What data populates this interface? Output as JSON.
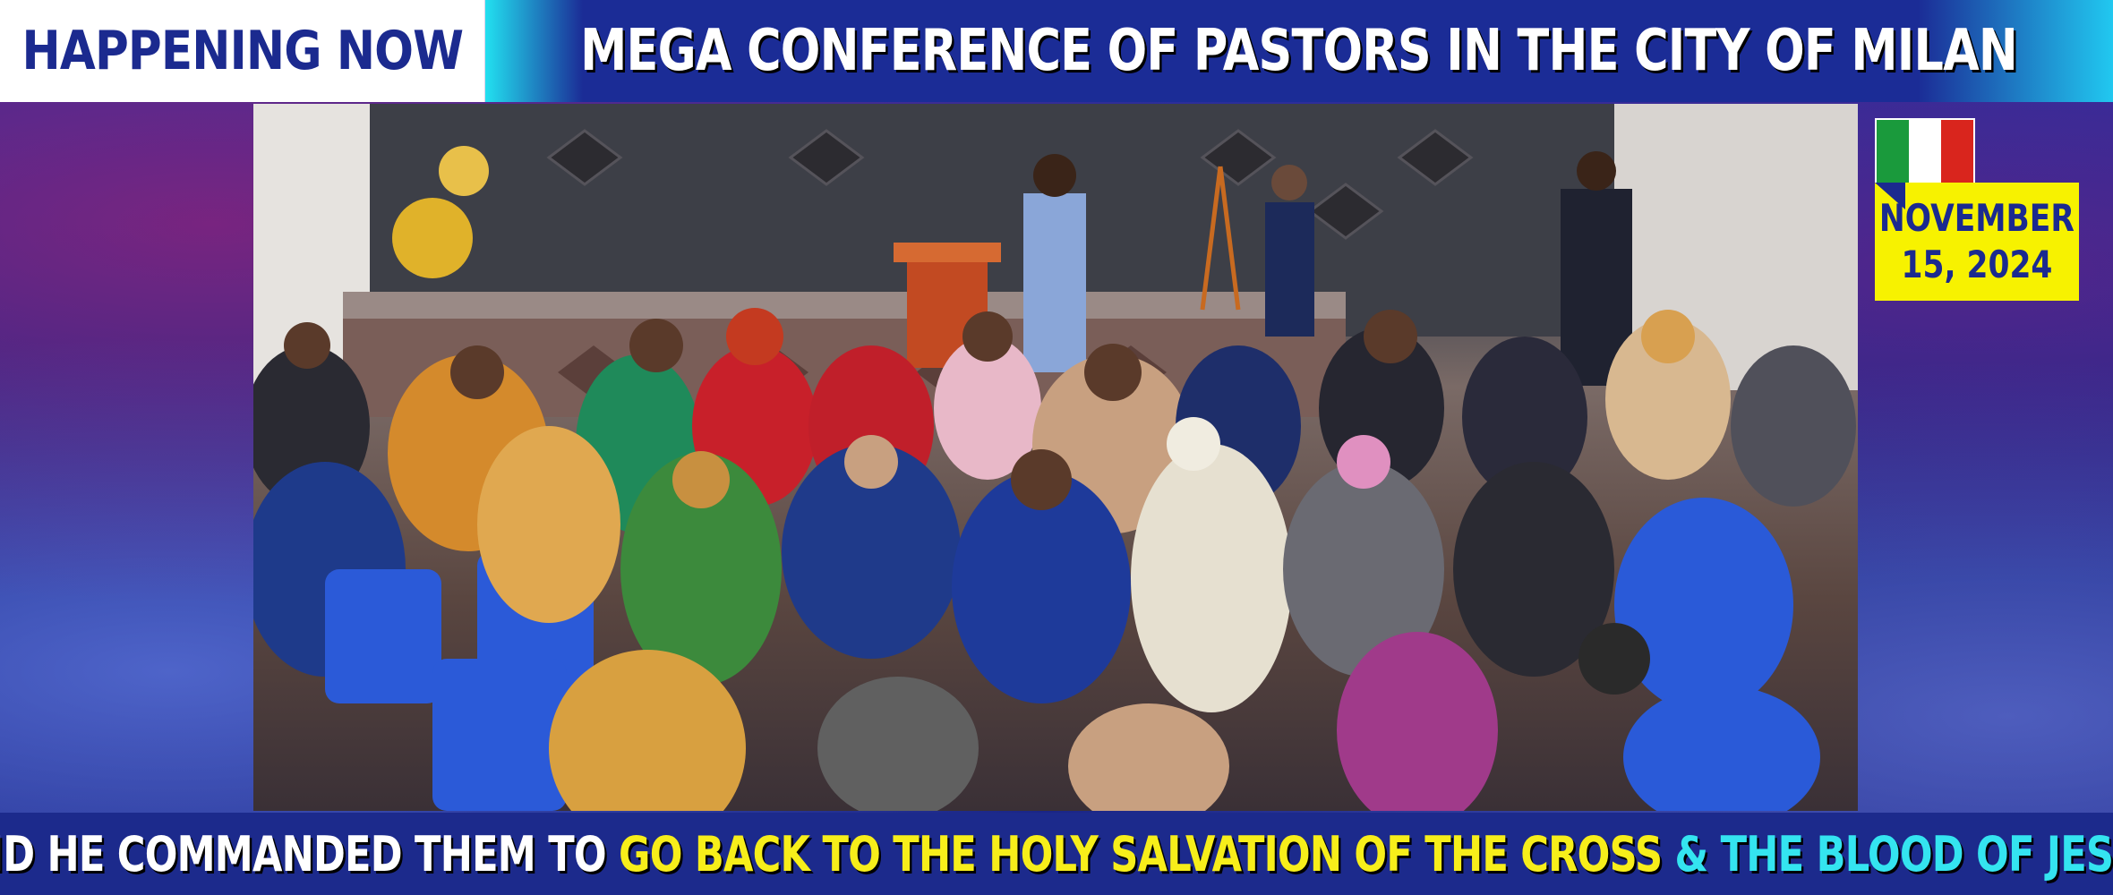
{
  "header": {
    "badge": "HAPPENING NOW",
    "title": "MEGA CONFERENCE OF PASTORS IN THE CITY OF MILAN"
  },
  "date": {
    "line1": "NOVEMBER",
    "line2": "15, 2024"
  },
  "flag": {
    "icon": "italy-flag-icon",
    "colors": [
      "#1a9a3c",
      "#ffffff",
      "#d9251d"
    ]
  },
  "caption": {
    "part1": "AND HE COMMANDED THEM TO ",
    "part2": "GO BACK TO THE HOLY SALVATION OF THE CROSS",
    "part3": " & THE BLOOD OF JESUS"
  },
  "colors": {
    "navy": "#1b2a8f",
    "yellow": "#f7ee1a",
    "cyan": "#34e4f0",
    "date_bg": "#f7f200"
  }
}
